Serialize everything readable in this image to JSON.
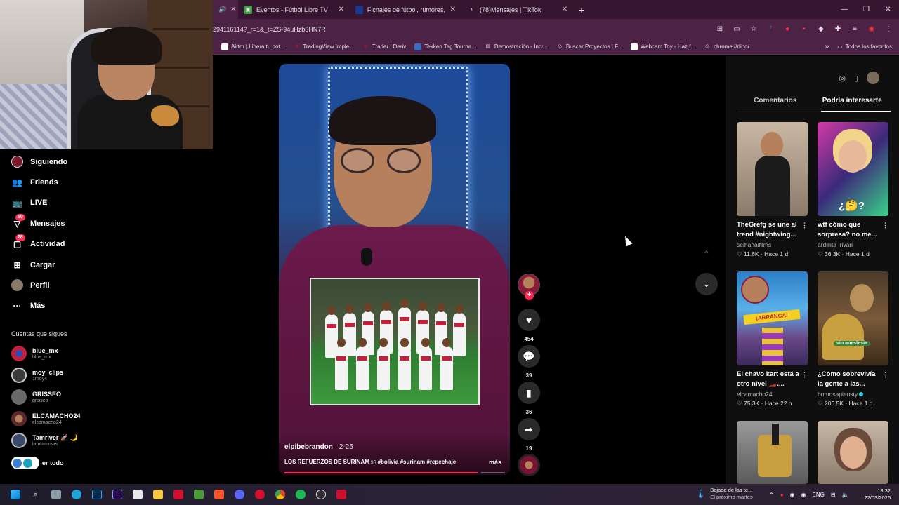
{
  "browser": {
    "tabs": [
      {
        "label": "",
        "favicon": "speaker-icon",
        "active": true
      },
      {
        "label": "Eventos - Fútbol Libre TV",
        "active": false,
        "favicon_color": "#3a9d46"
      },
      {
        "label": "Fichajes de fútbol, rumores, va",
        "active": false,
        "favicon_color": "#1b3a8f"
      },
      {
        "label": "(78)Mensajes | TikTok",
        "active": false,
        "favicon_color": "#000000"
      }
    ],
    "new_tab": "+",
    "url": "294116114?_r=1&_t=ZS-94uHzb5HN7R",
    "bookmarks": [
      {
        "label": "Airtm | Libera tu pot...",
        "color": "#ffffff"
      },
      {
        "label": "TradingView Imple...",
        "color": "#d0102c"
      },
      {
        "label": "Trader | Deriv",
        "color": "#d0102c"
      },
      {
        "label": "Tekken Tag Tourna...",
        "color": "#3b6cc0"
      },
      {
        "label": "Demostración - Incr...",
        "color": "#7a7a7a"
      },
      {
        "label": "Buscar Proyectos | F...",
        "color": "#9a9a9a"
      },
      {
        "label": "Webcam Toy - Haz f...",
        "color": "#ffffff"
      },
      {
        "label": "chrome://dino/",
        "color": "#9a9a9a"
      }
    ],
    "all_bookmarks": "Todos los favoritos"
  },
  "sidebar": {
    "nav": [
      {
        "label": "Siguiendo",
        "icon": "following-avatar-icon"
      },
      {
        "label": "Friends",
        "icon": "friends-icon"
      },
      {
        "label": "LIVE",
        "icon": "live-icon"
      },
      {
        "label": "Mensajes",
        "icon": "messages-icon",
        "badge": "50"
      },
      {
        "label": "Actividad",
        "icon": "activity-icon",
        "badge": "28"
      },
      {
        "label": "Cargar",
        "icon": "upload-icon"
      },
      {
        "label": "Perfil",
        "icon": "profile-icon"
      },
      {
        "label": "Más",
        "icon": "more-icon"
      }
    ],
    "accounts_title": "Cuentas que sigues",
    "accounts": [
      {
        "name": "blue_mx",
        "handle": "blue_mx",
        "color": "#c0203c"
      },
      {
        "name": "moy_clips",
        "handle": "1moy4",
        "color": "#3a3a3a"
      },
      {
        "name": "GRISSEO",
        "handle": "grisseo",
        "color": "#6a6a6a"
      },
      {
        "name": "ELCAMACHO24",
        "handle": "elcamacho24",
        "color": "#5a2a2a"
      },
      {
        "name": "Tamriver 🚀 🌙",
        "handle": "iamtamriver",
        "color": "#3b4a6a"
      }
    ],
    "see_all": "er todo"
  },
  "video": {
    "author": "elpibebrandon",
    "date": " · 2-25",
    "caption": "LOS REFUERZOS DE SURINAM",
    "caption_sub": " SR ",
    "hashtags": "#bolivia #surinam #repechaje",
    "more": "más",
    "progress_percent": 88
  },
  "actions": {
    "likes": "454",
    "comments": "39",
    "saves": "36",
    "shares": "19"
  },
  "right_panel": {
    "tabs": [
      "Comentarios",
      "Podría interesarte"
    ],
    "active_tab": 1,
    "cards": [
      {
        "title": "TheGrefg se une al trend #nightwing...",
        "author": "seihanaifilms",
        "likes": "11.6K",
        "age": "Hace 1 d",
        "verified": false
      },
      {
        "title": "wtf cómo que sorpresa? no me...",
        "author": "ardillita_rivari",
        "likes": "36.3K",
        "age": "Hace 1 d",
        "verified": false
      },
      {
        "title": "El chavo kart está a otro nivel 🏎️....",
        "author": "elcamacho24",
        "likes": "75.3K",
        "age": "Hace 22 h",
        "verified": false
      },
      {
        "title": "¿Cómo sobrevivía la gente a las...",
        "author": "homosapiensty",
        "likes": "206.5K",
        "age": "Hace 1 d",
        "verified": true
      },
      {
        "title": "",
        "author": "",
        "likes": "",
        "age": "",
        "verified": false
      },
      {
        "title": "",
        "author": "",
        "likes": "",
        "age": "",
        "verified": false
      }
    ],
    "thumb_texts": [
      "",
      "¿🤔?",
      "¡ARRANCA!",
      "sin anestesia",
      "",
      ""
    ]
  },
  "taskbar": {
    "weather_title": "Bajada de las te...",
    "weather_sub": "El próximo martes",
    "language": "ENG",
    "time": "13:32",
    "date": "22/03/2026"
  }
}
